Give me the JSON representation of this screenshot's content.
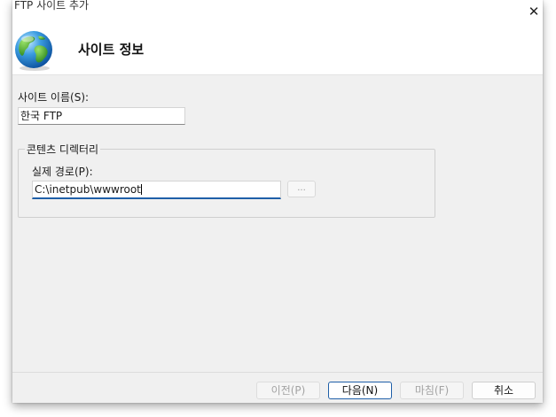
{
  "window": {
    "title": "FTP 사이트 추가",
    "close_glyph": "✕"
  },
  "header": {
    "title": "사이트 정보",
    "icon": "globe-icon"
  },
  "site_name": {
    "label": "사이트 이름(S):",
    "value": "한국 FTP"
  },
  "content_directory": {
    "legend": "콘텐츠 디렉터리",
    "physical_path_label": "실제 경로(P):",
    "physical_path_value": "C:\\inetpub\\wwwroot",
    "browse_label": "..."
  },
  "footer": {
    "previous_label": "이전(P)",
    "next_label": "다음(N)",
    "finish_label": "마침(F)",
    "cancel_label": "취소"
  },
  "colors": {
    "dialog_bg": "#f0f0f0",
    "header_bg": "#ffffff",
    "focus_accent": "#1f5fa8",
    "disabled_text": "#a3a3a3"
  }
}
